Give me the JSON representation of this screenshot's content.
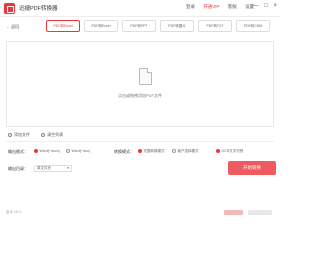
{
  "app": {
    "title": "迅捷PDF转换器"
  },
  "top_menu": {
    "items": [
      "登录",
      "开通VIP",
      "客服",
      "设置"
    ]
  },
  "window_controls": {
    "minimize": "—",
    "maximize": "□",
    "close": "×"
  },
  "nav": {
    "back_label": "返回"
  },
  "tabs": [
    {
      "label": "PDF转Excel",
      "active": true
    },
    {
      "label": "PDF转Excel",
      "active": false
    },
    {
      "label": "PDF转PPT",
      "active": false
    },
    {
      "label": "PDF转图片",
      "active": false
    },
    {
      "label": "PDF转TXT",
      "active": false
    },
    {
      "label": "PDF转CHM",
      "active": false
    }
  ],
  "dropzone": {
    "hint": "点击或拖拽添加PDF文件"
  },
  "file_actions": {
    "add_file": "添加文件",
    "clear_list": "清空列表"
  },
  "settings": {
    "output_format": {
      "label": "输出格式：",
      "options": [
        "Word(*.docx)",
        "Word(*.doc)"
      ],
      "selected": 0
    },
    "convert_mode": {
      "label": "转换模式：",
      "options": [
        "完整转换模式",
        "客户选择模式",
        "OCR文字识别"
      ],
      "selected": 0
    },
    "output_dir": {
      "label": "输出目录：",
      "value": "原文件夹"
    },
    "start_button": "开始转换"
  },
  "status": {
    "version": "版本 V8.0"
  },
  "colors": {
    "accent": "#e8383d",
    "button": "#ef5a5f"
  }
}
